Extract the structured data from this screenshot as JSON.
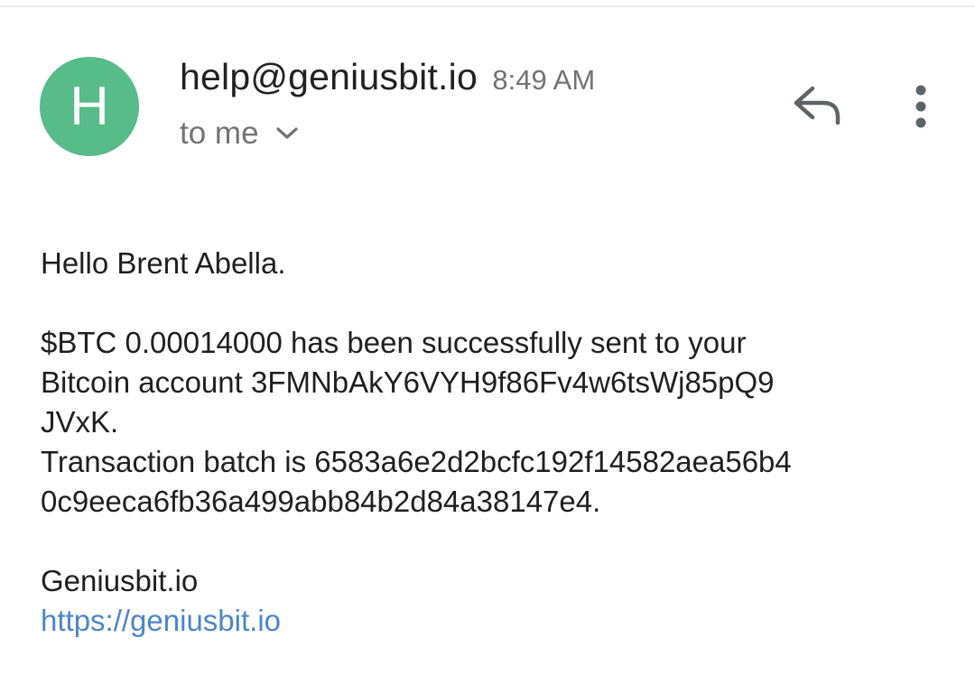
{
  "header": {
    "avatar_letter": "H",
    "avatar_color": "#57bb8a",
    "sender": "help@geniusbit.io",
    "time": "8:49 AM",
    "recipient": "to me",
    "icons": [
      "chevron-down-icon",
      "reply-icon",
      "more-vert-icon"
    ]
  },
  "message": {
    "greeting": "Hello Brent Abella.",
    "line1": "$BTC 0.00014000 has been successfully sent to your",
    "line2": "Bitcoin account 3FMNbAkY6VYH9f86Fv4w6tsWj85pQ9",
    "line3": "JVxK.",
    "line4": "Transaction batch is 6583a6e2d2bcfc192f14582aea56b4",
    "line5": "0c9eeca6fb36a499abb84b2d84a38147e4.",
    "signature": "Geniusbit.io",
    "link": "https://geniusbit.io"
  },
  "colors": {
    "link": "#4a86c8",
    "text": "#1f1f1f",
    "muted": "#737373"
  }
}
